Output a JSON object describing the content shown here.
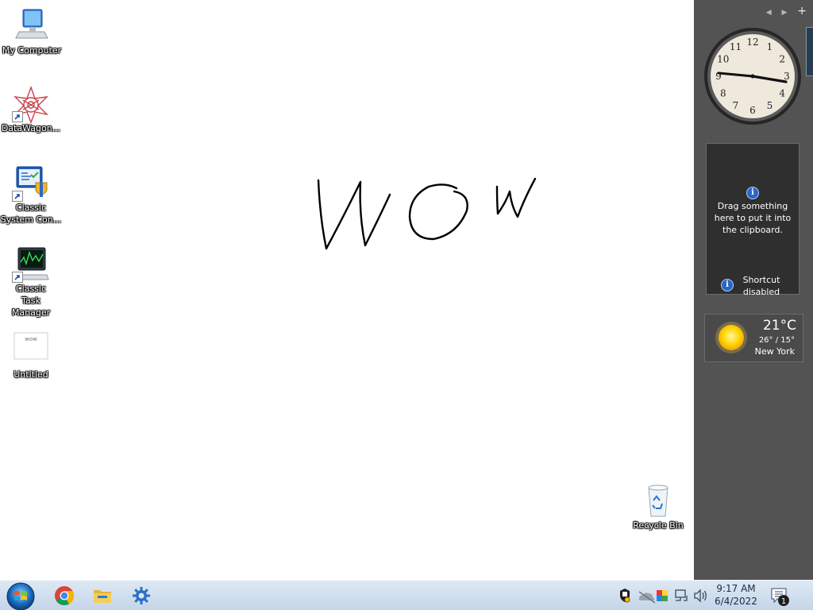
{
  "desktop": {
    "icons": [
      {
        "label": "My Computer",
        "icon": "computer-icon"
      },
      {
        "label": "DataWagon...",
        "icon": "datawagon-icon"
      },
      {
        "label": "Classic System Con...",
        "icon": "control-panel-icon"
      },
      {
        "label": "Classic Task Manager",
        "icon": "task-manager-icon"
      },
      {
        "label": "Untitled",
        "icon": "paint-document-icon"
      }
    ],
    "recycle_bin": {
      "label": "Recycle Bin",
      "icon": "recycle-bin-icon"
    },
    "drawing_text": "wow"
  },
  "sidebar": {
    "controls": {
      "prev": "◀",
      "next": "▶",
      "add": "+"
    },
    "clock": {
      "numbers": [
        "12",
        "1",
        "2",
        "3",
        "4",
        "5",
        "6",
        "7",
        "8",
        "9",
        "10",
        "11"
      ]
    },
    "clipboard": {
      "message": "Drag something here to put it into the clipboard.",
      "footer": "Shortcut disabled",
      "info_glyph": "i"
    },
    "weather": {
      "temperature": "21°C",
      "range": "26° / 15°",
      "city": "New York",
      "icon": "sun-icon"
    }
  },
  "taskbar": {
    "start": "start-orb-icon",
    "pinned": [
      "chrome-icon",
      "file-explorer-icon",
      "settings-icon"
    ],
    "tray_icons": [
      "action-center-flag-icon",
      "onedrive-icon",
      "color-app-icon",
      "network-icon",
      "volume-icon"
    ],
    "time": "9:17 AM",
    "date": "6/4/2022",
    "notification_count": "1"
  },
  "colors": {
    "sidebar_bg": "#535353",
    "taskbar_top": "#dde8f4",
    "taskbar_bottom": "#c4d5e8",
    "accent_blue": "#2a66c8"
  }
}
